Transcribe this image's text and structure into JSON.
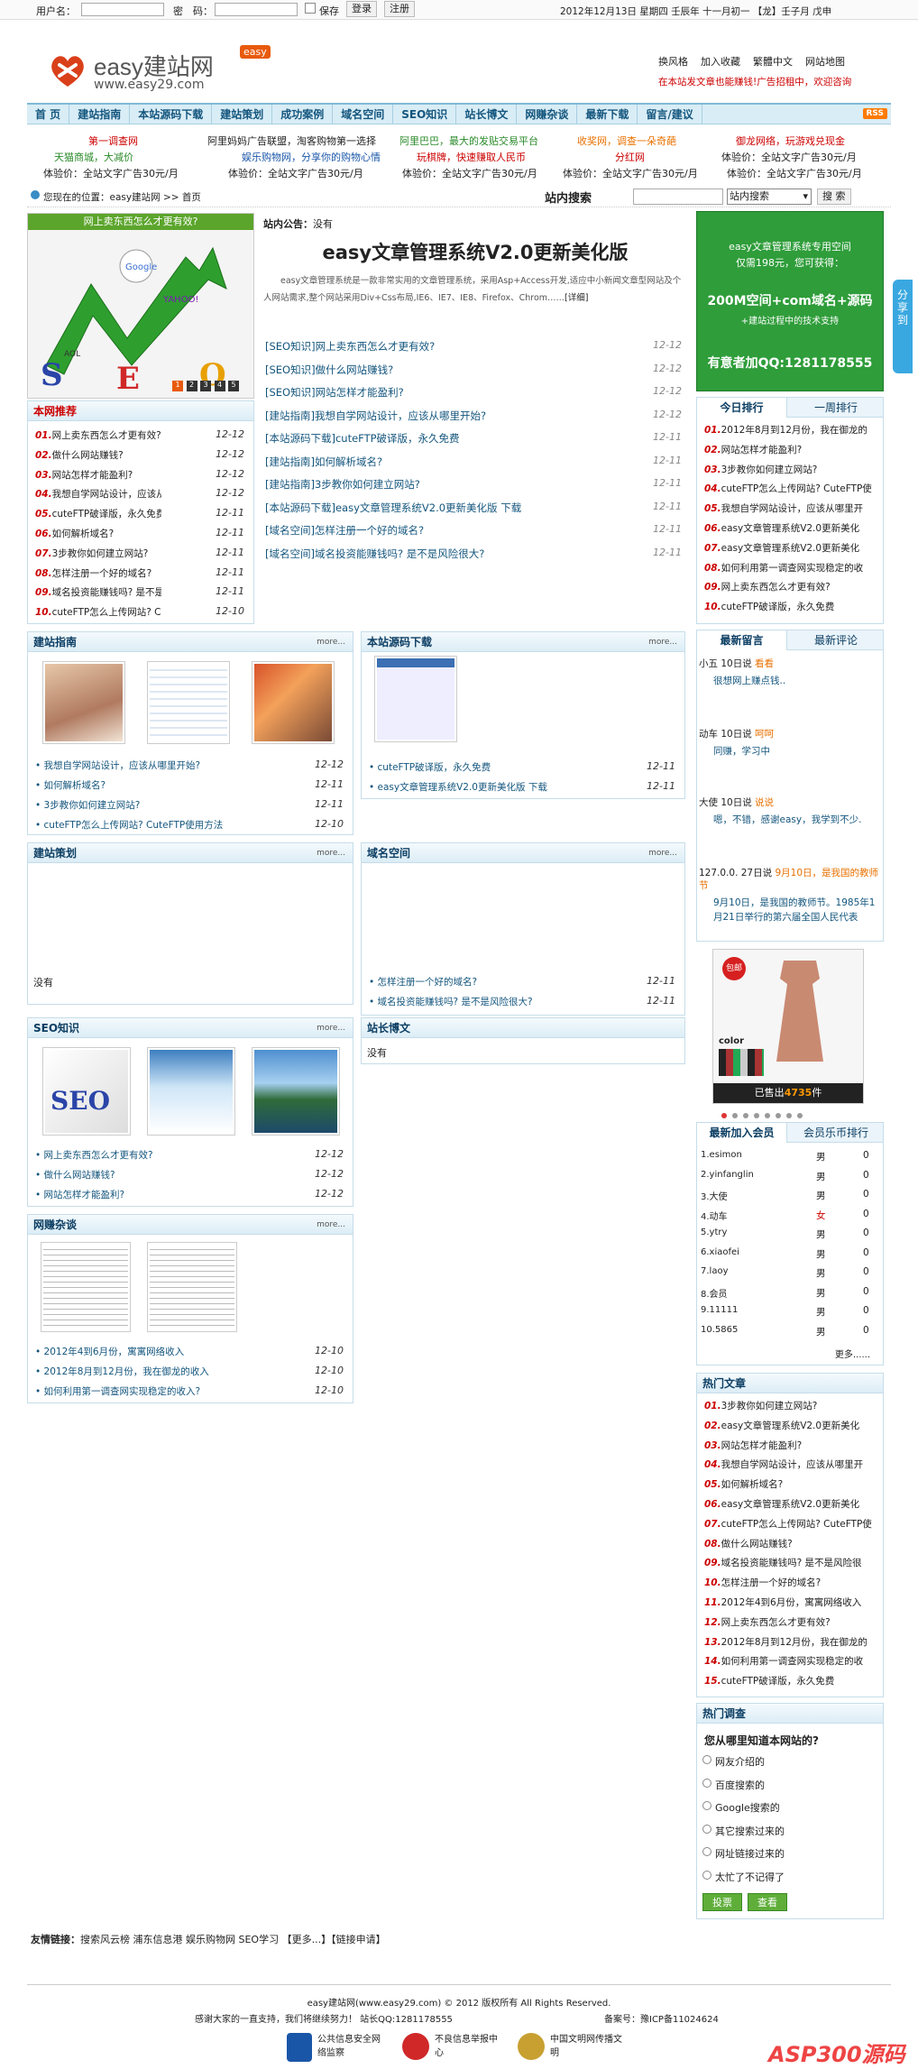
{
  "topbar": {
    "username_label": "用户名：",
    "password_label": "密　码：",
    "remember_label": "保存",
    "login_label": "登录",
    "register_label": "注册",
    "date_text": "2012年12月13日 星期四 壬辰年 十一月初一 【龙】壬子月 戊申"
  },
  "logo": {
    "title": "easy建站网",
    "url": "www.easy29.com",
    "tag": "easy"
  },
  "header_links": [
    "换风格",
    "加入收藏",
    "繁體中文",
    "网站地图"
  ],
  "header_notice": "在本站发文章也能赚钱!广告招租中，欢迎咨询",
  "nav": [
    "首 页",
    "建站指南",
    "本站源码下载",
    "建站策划",
    "成功案例",
    "域名空间",
    "SEO知识",
    "站长博文",
    "网赚杂谈",
    "最新下载",
    "留言/建议"
  ],
  "nav_rss": "RSS",
  "ads_row1": [
    "第一调查网",
    "阿里妈妈广告联盟，淘客购物第一选择",
    "阿里巴巴，最大的发贴交易平台",
    "收奖网，调查一朵奇葩",
    "御龙网络，玩游戏兑现金"
  ],
  "ads_row2": [
    "天猫商城，大减价",
    "娱乐购物网，分享你的购物心情",
    "玩棋牌，快速赚取人民币",
    "分红网",
    "体验价：全站文字广告30元/月"
  ],
  "ads_row3": [
    "体验价：全站文字广告30元/月",
    "体验价：全站文字广告30元/月",
    "体验价：全站文字广告30元/月",
    "体验价：全站文字广告30元/月",
    "体验价：全站文字广告30元/月"
  ],
  "location": {
    "prefix": "您现在的位置：",
    "site": "easy建站网",
    "sep": ">>",
    "page": "首页"
  },
  "search": {
    "label": "站内搜索",
    "select": "站内搜索",
    "button": "搜 索"
  },
  "slide": {
    "caption": "网上卖东西怎么才更有效?",
    "pages": [
      "1",
      "2",
      "3",
      "4",
      "5"
    ]
  },
  "notice": {
    "label": "站内公告：",
    "text": "没有"
  },
  "headline": {
    "title": "easy文章管理系统V2.0更新美化版",
    "summary": "easy文章管理系统是一款非常实用的文章管理系统，采用Asp+Access开发,适应中小新闻文章型网站及个人网站需求,整个网站采用Div+Css布局,IE6、IE7、IE8、Firefox、Chrom……",
    "more": "[详细]"
  },
  "center_list": [
    {
      "text": "[SEO知识]网上卖东西怎么才更有效?",
      "date": "12-12"
    },
    {
      "text": "[SEO知识]做什么网站赚钱?",
      "date": "12-12"
    },
    {
      "text": "[SEO知识]网站怎样才能盈利?",
      "date": "12-12"
    },
    {
      "text": "[建站指南]我想自学网站设计，应该从哪里开始?",
      "date": "12-12"
    },
    {
      "text": "[本站源码下载]cuteFTP破译版，永久免费",
      "date": "12-11"
    },
    {
      "text": "[建站指南]如何解析域名?",
      "date": "12-11"
    },
    {
      "text": "[建站指南]3步教你如何建立网站?",
      "date": "12-11"
    },
    {
      "text": "[本站源码下载]easy文章管理系统V2.0更新美化版 下载",
      "date": "12-11"
    },
    {
      "text": "[域名空间]怎样注册一个好的域名?",
      "date": "12-11"
    },
    {
      "text": "[域名空间]域名投资能赚钱吗? 是不是风险很大?",
      "date": "12-11"
    }
  ],
  "ad_box": {
    "line1": "easy文章管理系统专用空间",
    "line2": "仅需198元，您可获得：",
    "line3": "200M空间+com域名+源码",
    "line4": "+建站过程中的技术支持",
    "line5": "有意者加QQ:1281178555"
  },
  "recommend": {
    "title": "本网推荐",
    "items": [
      {
        "n": "01.",
        "text": "网上卖东西怎么才更有效?",
        "date": "12-12"
      },
      {
        "n": "02.",
        "text": "做什么网站赚钱?",
        "date": "12-12"
      },
      {
        "n": "03.",
        "text": "网站怎样才能盈利?",
        "date": "12-12"
      },
      {
        "n": "04.",
        "text": "我想自学网站设计，应该从哪里开",
        "date": "12-12"
      },
      {
        "n": "05.",
        "text": "cuteFTP破译版，永久免费",
        "date": "12-11"
      },
      {
        "n": "06.",
        "text": "如何解析域名?",
        "date": "12-11"
      },
      {
        "n": "07.",
        "text": "3步教你如何建立网站?",
        "date": "12-11"
      },
      {
        "n": "08.",
        "text": "怎样注册一个好的域名?",
        "date": "12-11"
      },
      {
        "n": "09.",
        "text": "域名投资能赚钱吗? 是不是风险很",
        "date": "12-11"
      },
      {
        "n": "10.",
        "text": "cuteFTP怎么上传网站? CuteFTP使",
        "date": "12-10"
      }
    ]
  },
  "rank": {
    "tabs": [
      "今日排行",
      "一周排行"
    ],
    "items": [
      {
        "n": "01.",
        "text": "2012年8月到12月份，我在御龙的"
      },
      {
        "n": "02.",
        "text": "网站怎样才能盈利?"
      },
      {
        "n": "03.",
        "text": "3步教你如何建立网站?"
      },
      {
        "n": "04.",
        "text": "cuteFTP怎么上传网站? CuteFTP使"
      },
      {
        "n": "05.",
        "text": "我想自学网站设计，应该从哪里开"
      },
      {
        "n": "06.",
        "text": "easy文章管理系统V2.0更新美化"
      },
      {
        "n": "07.",
        "text": "easy文章管理系统V2.0更新美化"
      },
      {
        "n": "08.",
        "text": "如何利用第一调查网实现稳定的收"
      },
      {
        "n": "09.",
        "text": "网上卖东西怎么才更有效?"
      },
      {
        "n": "10.",
        "text": "cuteFTP破译版，永久免费"
      }
    ]
  },
  "sec_guide": {
    "title": "建站指南",
    "more": "more...",
    "items": [
      {
        "text": "我想自学网站设计，应该从哪里开始?",
        "date": "12-12"
      },
      {
        "text": "如何解析域名?",
        "date": "12-11"
      },
      {
        "text": "3步教你如何建立网站?",
        "date": "12-11"
      },
      {
        "text": "cuteFTP怎么上传网站? CuteFTP使用方法",
        "date": "12-10"
      }
    ]
  },
  "sec_source": {
    "title": "本站源码下载",
    "more": "more...",
    "items": [
      {
        "text": "cuteFTP破译版，永久免费",
        "date": "12-11"
      },
      {
        "text": "easy文章管理系统V2.0更新美化版 下载",
        "date": "12-11"
      }
    ]
  },
  "sec_plan": {
    "title": "建站策划",
    "more": "more...",
    "empty": "没有"
  },
  "sec_domain": {
    "title": "域名空间",
    "more": "more...",
    "items": [
      {
        "text": "怎样注册一个好的域名?",
        "date": "12-11"
      },
      {
        "text": "域名投资能赚钱吗? 是不是风险很大?",
        "date": "12-11"
      }
    ]
  },
  "sec_seo": {
    "title": "SEO知识",
    "more": "more...",
    "items": [
      {
        "text": "网上卖东西怎么才更有效?",
        "date": "12-12"
      },
      {
        "text": "做什么网站赚钱?",
        "date": "12-12"
      },
      {
        "text": "网站怎样才能盈利?",
        "date": "12-12"
      }
    ]
  },
  "sec_blog": {
    "title": "站长博文",
    "empty": "没有"
  },
  "sec_talk": {
    "title": "网赚杂谈",
    "more": "more...",
    "items": [
      {
        "text": "2012年4到6月份，寓寓网络收入",
        "date": "12-10"
      },
      {
        "text": "2012年8月到12月份，我在御龙的收入",
        "date": "12-10"
      },
      {
        "text": "如何利用第一调查网实现稳定的收入?",
        "date": "12-10"
      }
    ]
  },
  "messages": {
    "tabs": [
      "最新留言",
      "最新评论"
    ],
    "items": [
      {
        "who": "小五 10日说",
        "tag": "看看",
        "body": "很想网上赚点钱.."
      },
      {
        "who": "动车 10日说",
        "tag": "呵呵",
        "body": "同赚，学习中"
      },
      {
        "who": "大使 10日说",
        "tag": "说说",
        "body": "嗯，不错，感谢easy，我学到不少."
      },
      {
        "who": "127.0.0. 27日说",
        "tag": "9月10日，是我国的教师节",
        "body": "9月10日，是我国的教师节。1985年1月21日举行的第六届全国人民代表"
      }
    ]
  },
  "shop": {
    "color": "color",
    "sold_prefix": "已售出",
    "sold": "4735",
    "sold_suffix": "件",
    "badge": "包邮"
  },
  "members": {
    "tabs": [
      "最新加入会员",
      "会员乐币排行"
    ],
    "rows": [
      {
        "name": "1.esimon",
        "sex": "男",
        "coin": "0"
      },
      {
        "name": "2.yinfanglin",
        "sex": "男",
        "coin": "0"
      },
      {
        "name": "3.大使",
        "sex": "男",
        "coin": "0"
      },
      {
        "name": "4.动车",
        "sex": "女",
        "coin": "0"
      },
      {
        "name": "5.ytry",
        "sex": "男",
        "coin": "0"
      },
      {
        "name": "6.xiaofei",
        "sex": "男",
        "coin": "0"
      },
      {
        "name": "7.laoy",
        "sex": "男",
        "coin": "0"
      },
      {
        "name": "8.会员",
        "sex": "男",
        "coin": "0"
      },
      {
        "name": "9.11111",
        "sex": "男",
        "coin": "0"
      },
      {
        "name": "10.5865",
        "sex": "男",
        "coin": "0"
      }
    ],
    "more": "更多......"
  },
  "hot": {
    "title": "热门文章",
    "items": [
      {
        "n": "01.",
        "text": "3步教你如何建立网站?"
      },
      {
        "n": "02.",
        "text": "easy文章管理系统V2.0更新美化"
      },
      {
        "n": "03.",
        "text": "网站怎样才能盈利?"
      },
      {
        "n": "04.",
        "text": "我想自学网站设计，应该从哪里开"
      },
      {
        "n": "05.",
        "text": "如何解析域名?"
      },
      {
        "n": "06.",
        "text": "easy文章管理系统V2.0更新美化"
      },
      {
        "n": "07.",
        "text": "cuteFTP怎么上传网站? CuteFTP使"
      },
      {
        "n": "08.",
        "text": "做什么网站赚钱?"
      },
      {
        "n": "09.",
        "text": "域名投资能赚钱吗? 是不是风险很"
      },
      {
        "n": "10.",
        "text": "怎样注册一个好的域名?"
      },
      {
        "n": "11.",
        "text": "2012年4到6月份，寓寓网络收入"
      },
      {
        "n": "12.",
        "text": "网上卖东西怎么才更有效?"
      },
      {
        "n": "13.",
        "text": "2012年8月到12月份，我在御龙的"
      },
      {
        "n": "14.",
        "text": "如何利用第一调查网实现稳定的收"
      },
      {
        "n": "15.",
        "text": "cuteFTP破译版，永久免费"
      }
    ]
  },
  "survey": {
    "title": "热门调查",
    "question": "您从哪里知道本网站的?",
    "options": [
      "网友介绍的",
      "百度搜索的",
      "Google搜索的",
      "其它搜索过来的",
      "网址链接过来的",
      "太忙了不记得了"
    ],
    "vote": "投票",
    "view": "查看"
  },
  "links": {
    "label": "友情链接：",
    "text": "搜索风云榜  浦东信息港  娱乐购物网  SEO学习  【更多...】【链接申请】"
  },
  "footer": {
    "line1": "easy建站网(www.easy29.com) © 2012 版权所有 All Rights Reserved.",
    "line2": "感谢大家的一直支持，我们将继续努力！  站长QQ:1281178555",
    "icp": "备案号：豫ICP备11024624",
    "badges": [
      "公共信息安全网络监察",
      "不良信息举报中心",
      "中国文明网传播文明"
    ],
    "watermark": "ASP300源码"
  },
  "share": "分享到"
}
